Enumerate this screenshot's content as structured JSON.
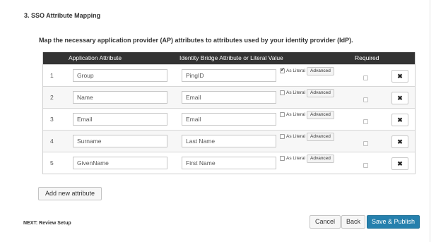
{
  "section": {
    "title": "3. SSO Attribute Mapping",
    "instructions": "Map the necessary application provider (AP) attributes to attributes used by your identity provider (IdP)."
  },
  "table": {
    "headers": {
      "application_attribute": "Application Attribute",
      "identity_bridge_attribute": "Identity Bridge Attribute or Literal Value",
      "required": "Required"
    },
    "as_literal_label": "As Literal",
    "advanced_label": "Advanced",
    "delete_glyph": "✖",
    "rows": [
      {
        "num": "1",
        "app_attr": "Group",
        "idb_attr": "PingID",
        "as_literal": true,
        "required": false
      },
      {
        "num": "2",
        "app_attr": "Name",
        "idb_attr": "Email",
        "as_literal": false,
        "required": false
      },
      {
        "num": "3",
        "app_attr": "Email",
        "idb_attr": "Email",
        "as_literal": false,
        "required": false
      },
      {
        "num": "4",
        "app_attr": "Surname",
        "idb_attr": "Last Name",
        "as_literal": false,
        "required": false
      },
      {
        "num": "5",
        "app_attr": "GivenName",
        "idb_attr": "First Name",
        "as_literal": false,
        "required": false
      }
    ]
  },
  "add_attribute_label": "Add new attribute",
  "footer": {
    "next_label": "NEXT: Review Setup",
    "cancel_label": "Cancel",
    "back_label": "Back",
    "publish_label": "Save & Publish"
  },
  "colors": {
    "header_bg": "#333333",
    "primary_button": "#2580ad"
  }
}
